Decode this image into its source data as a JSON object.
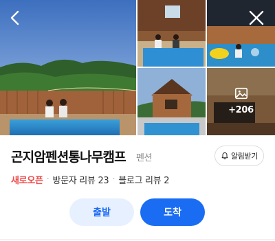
{
  "gallery": {
    "more_count": "+206",
    "icons": {
      "back": "chevron-left-icon",
      "close": "close-icon",
      "more": "image-icon"
    }
  },
  "place": {
    "name": "곤지암펜션통나무캠프",
    "category": "펜션",
    "alert_label": "알림받기",
    "new_open": "새로오픈",
    "visitor_reviews": "방문자 리뷰 23",
    "blog_reviews": "블로그 리뷰 2"
  },
  "actions": {
    "start_label": "출발",
    "arrive_label": "도착"
  },
  "colors": {
    "accent": "#1a6df3",
    "accent_light": "#e7f0fe",
    "new_open": "#f04b4b"
  }
}
